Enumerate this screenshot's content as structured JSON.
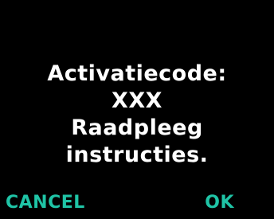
{
  "dialog": {
    "lines": [
      "Activatiecode:",
      "XXX",
      "Raadpleeg",
      "instructies."
    ]
  },
  "softkeys": {
    "left_label": "CANCEL",
    "right_label": "OK"
  },
  "colors": {
    "background": "#000000",
    "text": "#ffffff",
    "accent": "#1fc4a6"
  }
}
